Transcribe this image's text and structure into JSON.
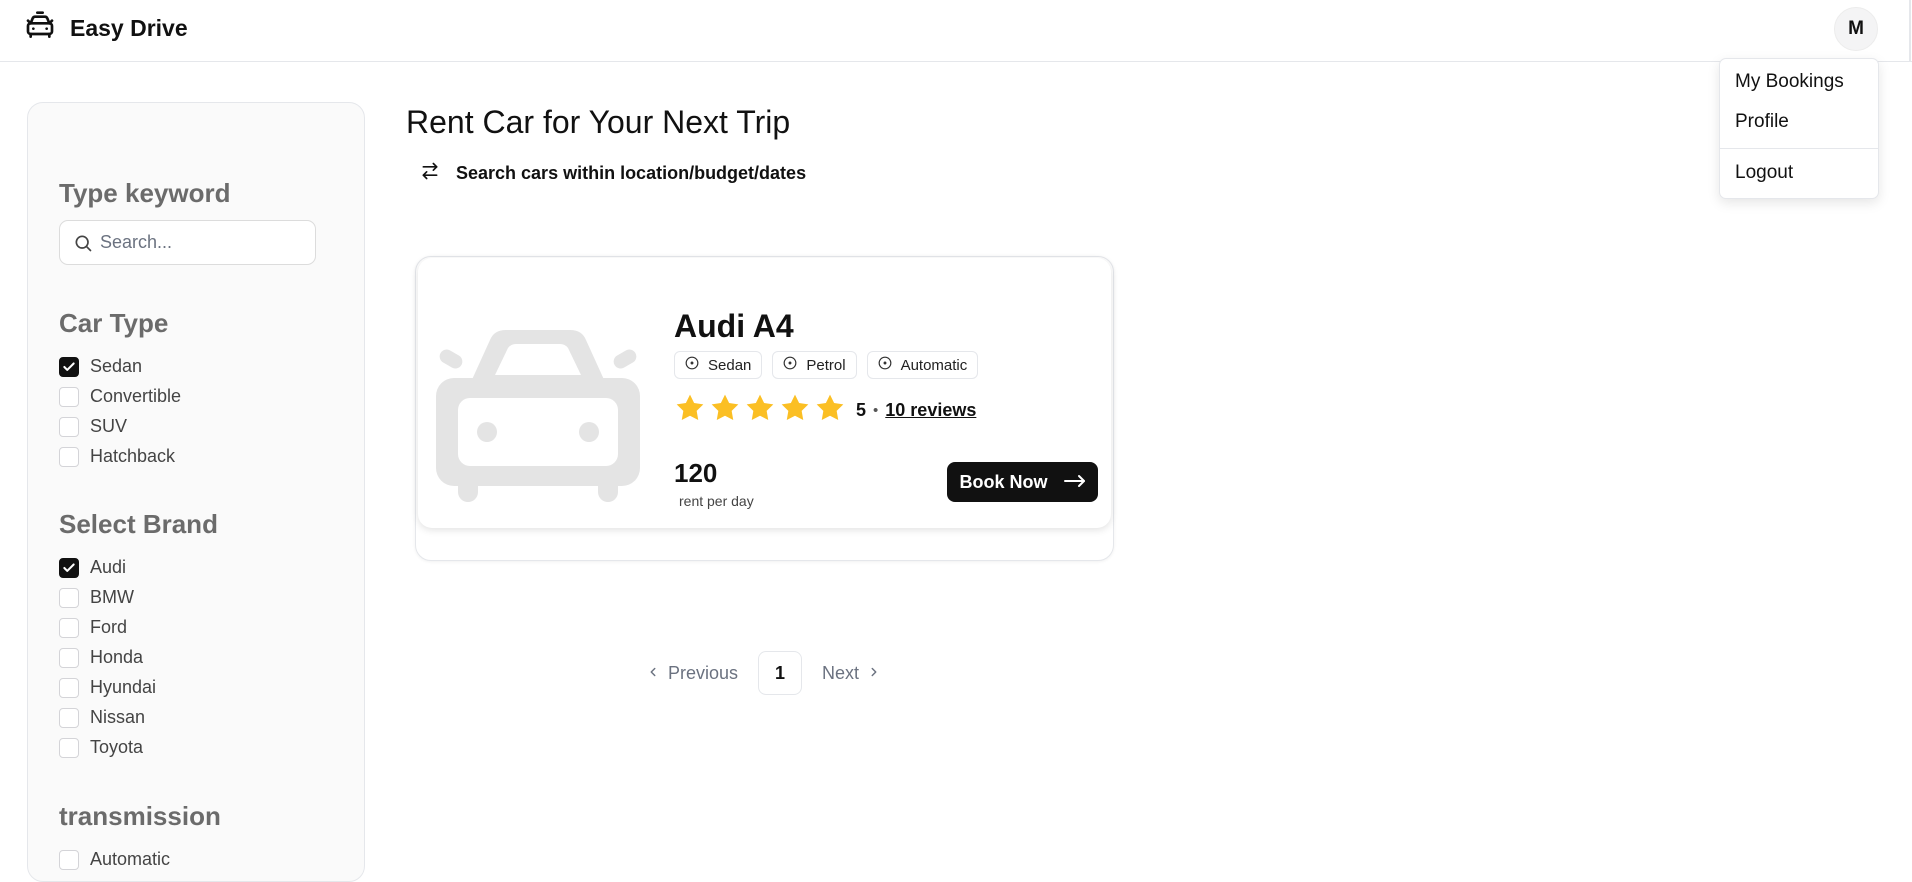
{
  "header": {
    "app_title": "Easy Drive",
    "avatar_initial": "M"
  },
  "user_menu": {
    "items": [
      "My Bookings",
      "Profile"
    ],
    "logout_label": "Logout"
  },
  "filters": {
    "keyword": {
      "title": "Type keyword",
      "placeholder": "Search..."
    },
    "car_type": {
      "title": "Car Type",
      "options": [
        {
          "label": "Sedan",
          "checked": true
        },
        {
          "label": "Convertible",
          "checked": false
        },
        {
          "label": "SUV",
          "checked": false
        },
        {
          "label": "Hatchback",
          "checked": false
        }
      ]
    },
    "brand": {
      "title": "Select Brand",
      "options": [
        {
          "label": "Audi",
          "checked": true
        },
        {
          "label": "BMW",
          "checked": false
        },
        {
          "label": "Ford",
          "checked": false
        },
        {
          "label": "Honda",
          "checked": false
        },
        {
          "label": "Hyundai",
          "checked": false
        },
        {
          "label": "Nissan",
          "checked": false
        },
        {
          "label": "Toyota",
          "checked": false
        }
      ]
    },
    "transmission": {
      "title": "transmission",
      "options": [
        {
          "label": "Automatic",
          "checked": false
        }
      ]
    }
  },
  "main": {
    "title": "Rent Car for Your Next Trip",
    "search_toggle_label": "Search cars within location/budget/dates"
  },
  "car": {
    "name": "Audi A4",
    "tags": [
      "Sedan",
      "Petrol",
      "Automatic"
    ],
    "rating": "5",
    "stars": 5,
    "reviews_label": "10 reviews",
    "price": "120",
    "price_unit": "rent per day",
    "book_label": "Book Now"
  },
  "pagination": {
    "previous_label": "Previous",
    "current_page": "1",
    "next_label": "Next"
  },
  "colors": {
    "star": "#fbbf24",
    "primary": "#111111",
    "placeholder_car": "#e4e4e4"
  }
}
